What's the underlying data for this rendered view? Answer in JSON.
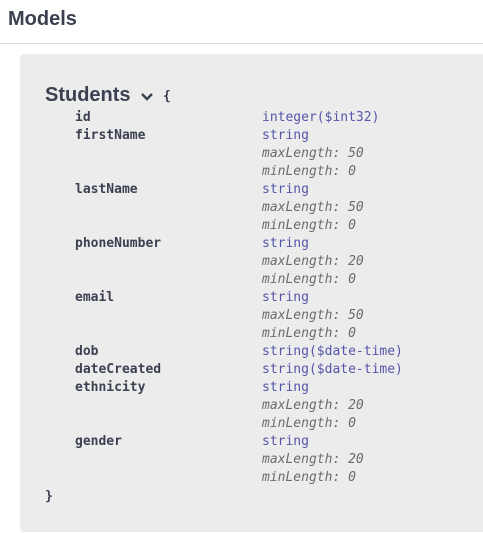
{
  "header": {
    "title": "Models"
  },
  "model": {
    "name": "Students",
    "open_brace": "{",
    "close_brace": "}",
    "properties": [
      {
        "name": "id",
        "type": "integer",
        "format": "($int32)"
      },
      {
        "name": "firstName",
        "type": "string",
        "constraints": [
          "maxLength: 50",
          "minLength: 0"
        ]
      },
      {
        "name": "lastName",
        "type": "string",
        "constraints": [
          "maxLength: 50",
          "minLength: 0"
        ]
      },
      {
        "name": "phoneNumber",
        "type": "string",
        "constraints": [
          "maxLength: 20",
          "minLength: 0"
        ]
      },
      {
        "name": "email",
        "type": "string",
        "constraints": [
          "maxLength: 50",
          "minLength: 0"
        ]
      },
      {
        "name": "dob",
        "type": "string",
        "format": "($date-time)"
      },
      {
        "name": "dateCreated",
        "type": "string",
        "format": "($date-time)"
      },
      {
        "name": "ethnicity",
        "type": "string",
        "constraints": [
          "maxLength: 20",
          "minLength: 0"
        ]
      },
      {
        "name": "gender",
        "type": "string",
        "constraints": [
          "maxLength: 20",
          "minLength: 0"
        ]
      }
    ]
  }
}
